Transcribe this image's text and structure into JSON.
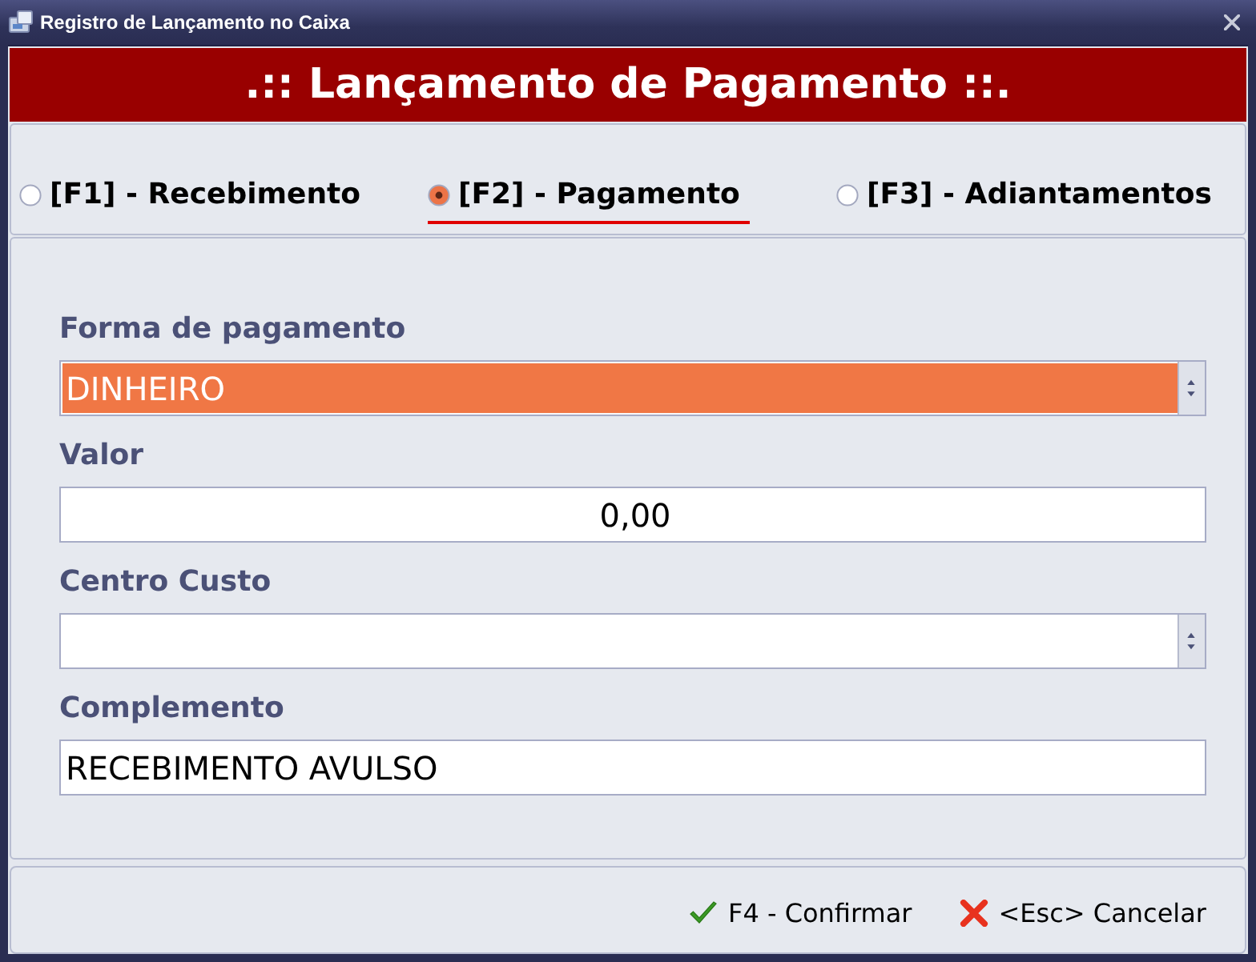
{
  "window": {
    "title": "Registro de Lançamento no Caixa"
  },
  "header": {
    "title": ".:: Lançamento de Pagamento ::."
  },
  "operation_types": [
    {
      "label": "[F1] - Recebimento",
      "selected": false
    },
    {
      "label": "[F2] - Pagamento",
      "selected": true
    },
    {
      "label": "[F3] - Adiantamentos",
      "selected": false
    }
  ],
  "fields": [
    {
      "kind": "select",
      "label": "Forma de pagamento",
      "value": "DINHEIRO",
      "focused": true
    },
    {
      "kind": "number",
      "label": "Valor",
      "value": "0,00",
      "focused": false
    },
    {
      "kind": "select",
      "label": "Centro Custo",
      "focused": false
    },
    {
      "kind": "text",
      "label": "Complemento",
      "value": "RECEBIMENTO AVULSO",
      "focused": false
    }
  ],
  "buttons": [
    {
      "kind": "confirm",
      "label": "F4 - Confirmar"
    },
    {
      "kind": "cancel",
      "label": "<Esc> Cancelar"
    }
  ]
}
